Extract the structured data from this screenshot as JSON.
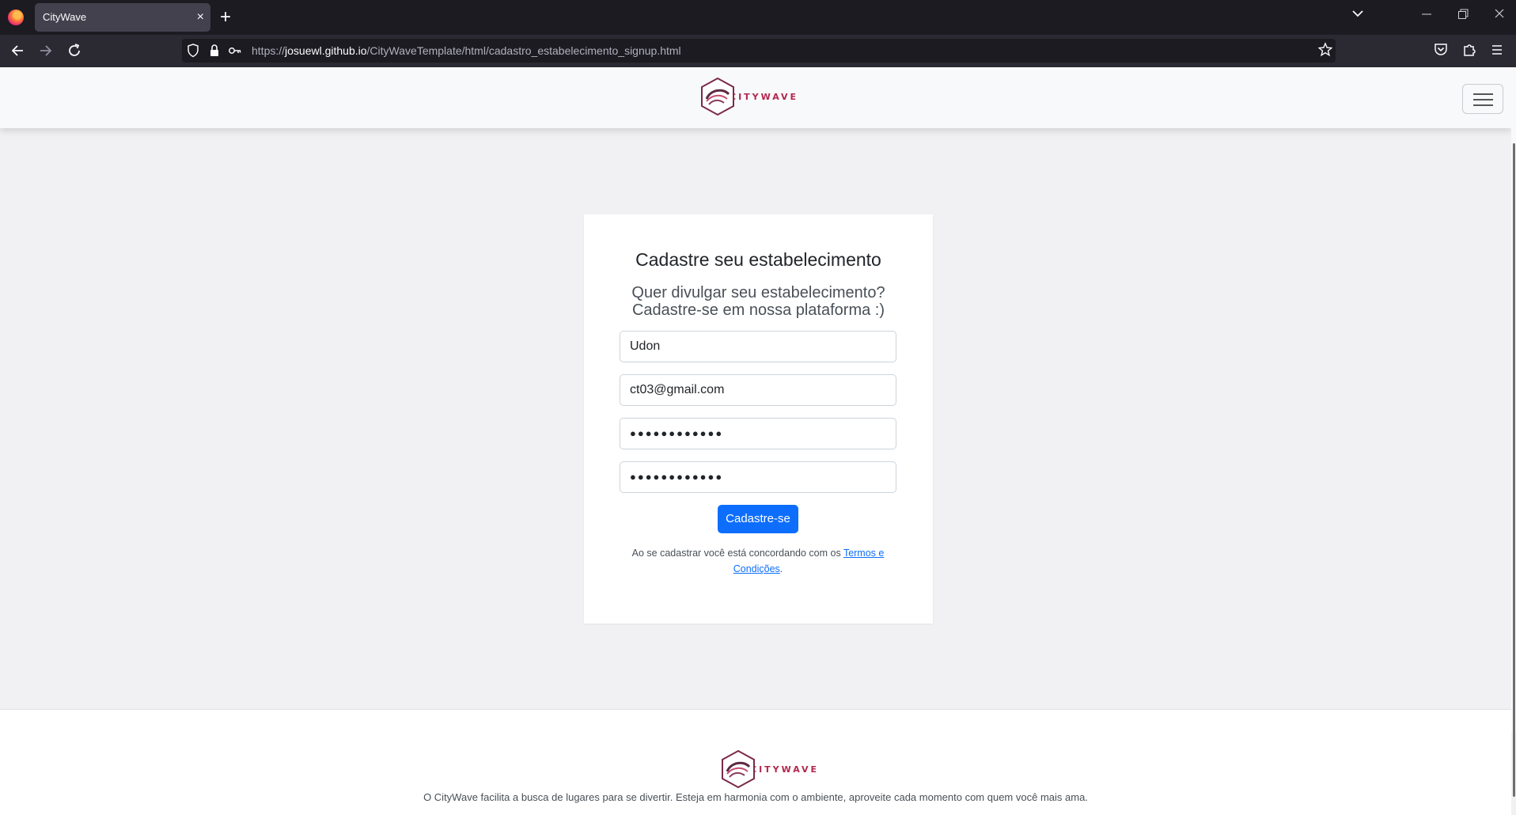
{
  "browser": {
    "tab_title": "CityWave",
    "tab_close": "×",
    "new_tab": "+",
    "url_prefix": "https://",
    "url_host": "josuewl.github.io",
    "url_path": "/CityWaveTemplate/html/cadastro_estabelecimento_signup.html"
  },
  "header": {
    "logo_text": "CITYWAVE"
  },
  "form": {
    "title": "Cadastre seu estabelecimento",
    "subtitle_line1": "Quer divulgar seu estabelecimento?",
    "subtitle_line2": "Cadastre-se em nossa plataforma :)",
    "name_value": "Udon",
    "email_value": "ct03@gmail.com",
    "password_value": "●●●●●●●●●●●●",
    "confirm_password_value": "●●●●●●●●●●●●",
    "submit_label": "Cadastre-se",
    "terms_prefix": "Ao se cadastrar você está concordando com os ",
    "terms_link": "Termos e Condições",
    "terms_suffix": "."
  },
  "footer": {
    "logo_text": "CITYWAVE",
    "description": "O CityWave facilita a busca de lugares para se divertir. Esteja em harmonia com o ambiente, aproveite cada momento com quem você mais ama."
  },
  "colors": {
    "primary_button": "#0d6efd",
    "brand": "#b3264e",
    "link": "#0d6efd"
  }
}
